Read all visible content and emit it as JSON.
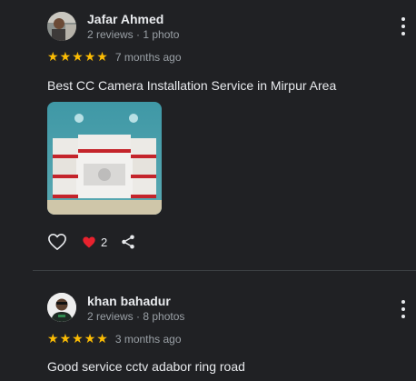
{
  "reviews": [
    {
      "name": "Jafar Ahmed",
      "meta": "2 reviews · 1 photo",
      "rating": 5,
      "time": "7 months ago",
      "text": "Best CC Camera Installation Service in Mirpur Area",
      "likes": "2"
    },
    {
      "name": "khan bahadur",
      "meta": "2 reviews · 8 photos",
      "rating": 5,
      "time": "3 months ago",
      "text": "Good service cctv adabor ring road"
    }
  ],
  "icons": {
    "star": "star-icon",
    "like": "thumb-heart-icon",
    "liked": "heart-icon",
    "share": "share-icon",
    "more": "more-vert-icon"
  },
  "colors": {
    "background": "#202124",
    "star": "#fbbc04",
    "heart": "#e8222e",
    "secondary_text": "#9aa0a6"
  }
}
